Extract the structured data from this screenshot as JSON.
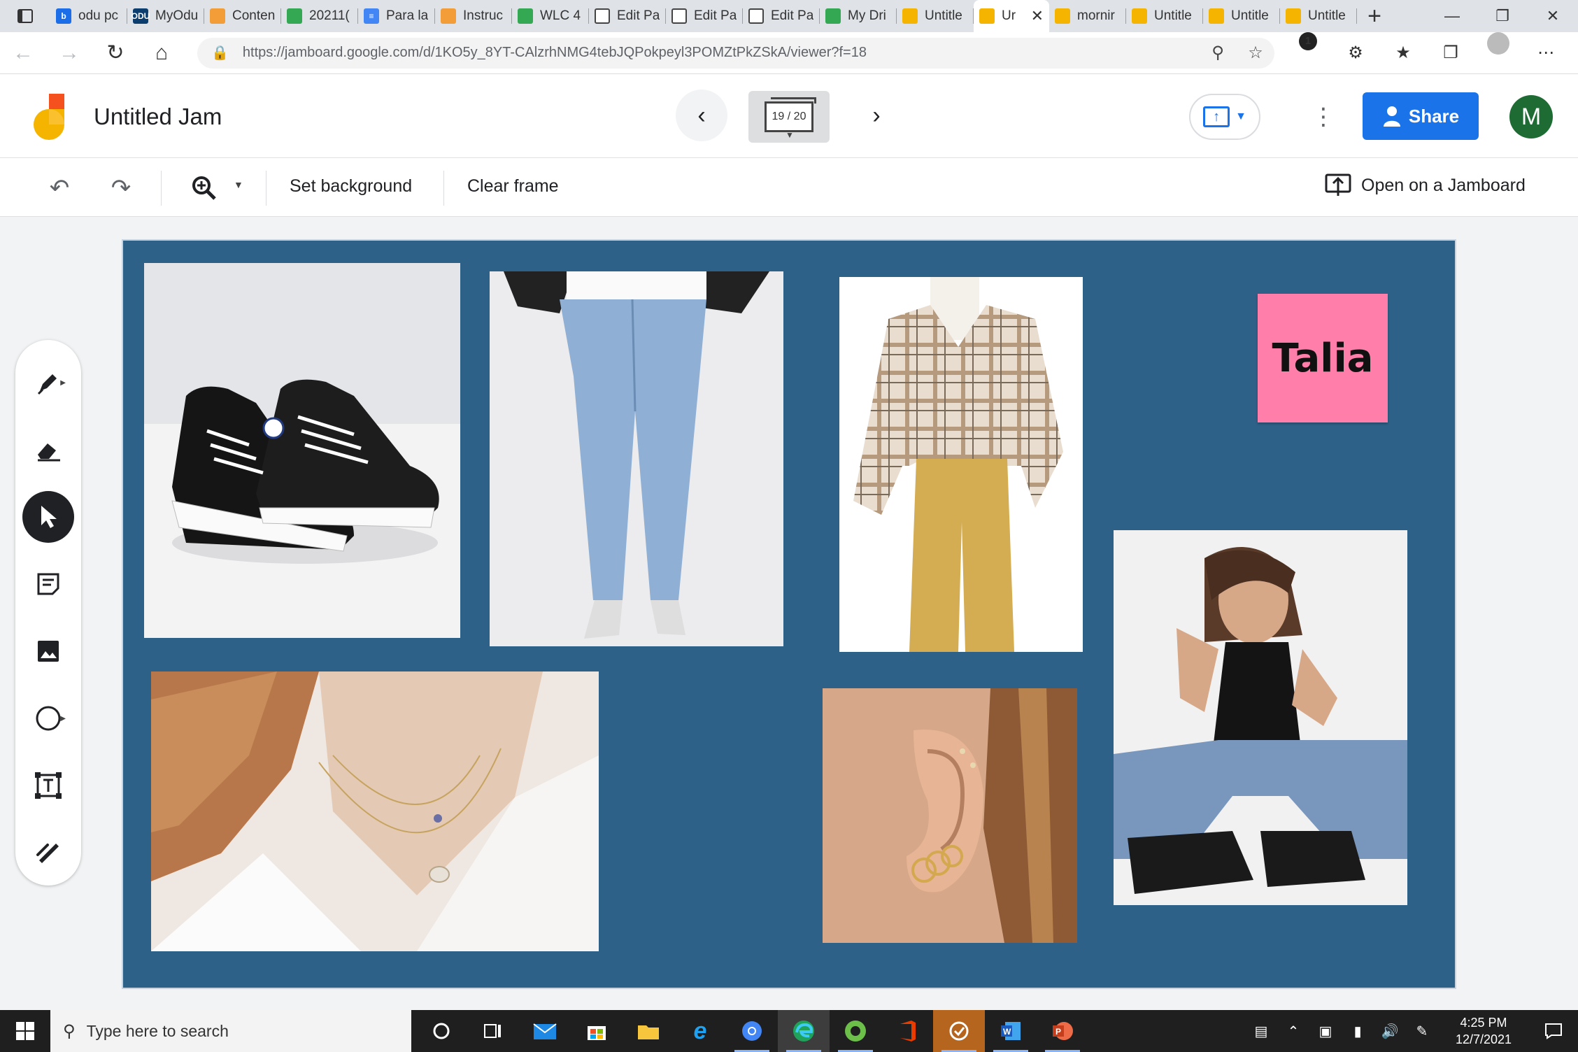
{
  "browser": {
    "tabs": [
      {
        "title": "odu pc",
        "color": "#1b6ee8",
        "glyph": "b"
      },
      {
        "title": "MyOdu",
        "color": "#0b3d6e",
        "glyph": "ODU"
      },
      {
        "title": "Conten",
        "color": "#f29d38",
        "glyph": ""
      },
      {
        "title": "20211(",
        "color": "#34a853",
        "glyph": ""
      },
      {
        "title": "Para la",
        "color": "#4285f4",
        "glyph": "≡"
      },
      {
        "title": "Instruc",
        "color": "#f29d38",
        "glyph": ""
      },
      {
        "title": "WLC 4",
        "color": "#34a853",
        "glyph": ""
      },
      {
        "title": "Edit Pa",
        "color": "#ffffff",
        "glyph": ""
      },
      {
        "title": "Edit Pa",
        "color": "#ffffff",
        "glyph": ""
      },
      {
        "title": "Edit Pa",
        "color": "#ffffff",
        "glyph": ""
      },
      {
        "title": "My Dri",
        "color": "#34a853",
        "glyph": ""
      },
      {
        "title": "Untitle",
        "color": "#f4b400",
        "glyph": ""
      },
      {
        "title": "Ur",
        "color": "#f4b400",
        "glyph": "",
        "active": true
      },
      {
        "title": "mornir",
        "color": "#f4b400",
        "glyph": ""
      },
      {
        "title": "Untitle",
        "color": "#f4b400",
        "glyph": ""
      },
      {
        "title": "Untitle",
        "color": "#f4b400",
        "glyph": ""
      },
      {
        "title": "Untitle",
        "color": "#f4b400",
        "glyph": ""
      }
    ],
    "url": "https://jamboard.google.com/d/1KO5y_8YT-CAlzrhNMG4tebJQPokpeyl3POMZtPkZSkA/viewer?f=18",
    "extension_badge": "1"
  },
  "jamboard": {
    "title": "Untitled Jam",
    "frame_counter": "19 / 20",
    "share_label": "Share",
    "avatar_letter": "M",
    "toolbar": {
      "set_background": "Set background",
      "clear_frame": "Clear frame",
      "open_on_jamboard": "Open on a Jamboard"
    },
    "sticky_note": {
      "text": "Talia",
      "color": "#ff7eaa"
    },
    "canvas_background": "#2e6188",
    "images": [
      {
        "name": "converse-sneakers-photo",
        "subject": "black high-top sneakers"
      },
      {
        "name": "mom-jeans-photo",
        "subject": "light wash jeans with white boots"
      },
      {
        "name": "plaid-shirt-photo",
        "subject": "oversized plaid shirt with mustard pants"
      },
      {
        "name": "model-sitting-photo",
        "subject": "woman in black tank and jeans"
      },
      {
        "name": "necklace-photo",
        "subject": "layered gold necklaces"
      },
      {
        "name": "earrings-photo",
        "subject": "gold hoop ear piercings"
      }
    ]
  },
  "taskbar": {
    "search_placeholder": "Type here to search",
    "time": "4:25 PM",
    "date": "12/7/2021"
  },
  "colors": {
    "accent": "#1a73e8",
    "avatar": "#1e6b34",
    "tabstrip": "#dfe3e8",
    "taskbar": "#1f1f1f"
  }
}
